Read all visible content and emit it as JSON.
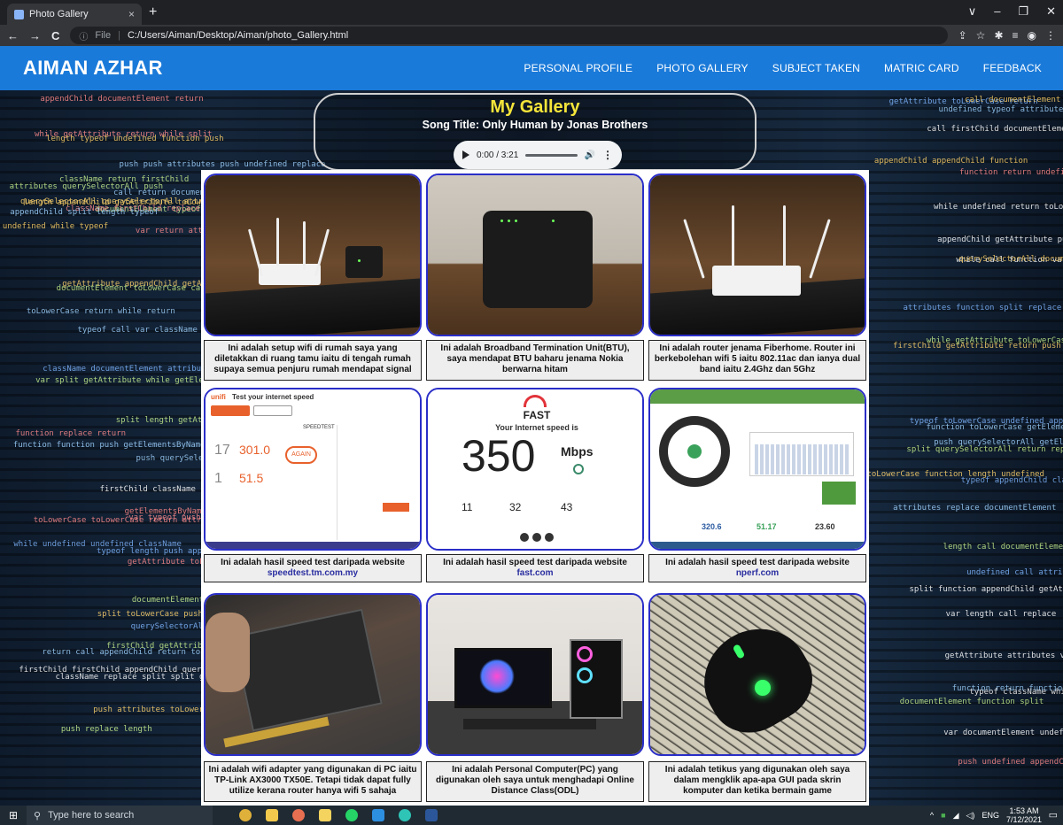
{
  "browser": {
    "tab_title": "Photo Gallery",
    "tab_close": "×",
    "new_tab": "+",
    "win_controls": [
      "∨",
      "–",
      "❐",
      "✕"
    ],
    "nav_back": "←",
    "nav_forward": "→",
    "nav_reload": "C",
    "address_scheme": "File",
    "address_url": "C:/Users/Aiman/Desktop/Aiman/photo_Gallery.html"
  },
  "navbar": {
    "brand": "AIMAN AZHAR",
    "links": [
      "PERSONAL PROFILE",
      "PHOTO GALLERY",
      "SUBJECT TAKEN",
      "MATRIC CARD",
      "FEEDBACK"
    ],
    "color": "#1a7ad9"
  },
  "gallery_header": {
    "title": "My Gallery",
    "song": "Song Title: Only Human by Jonas Brothers",
    "audio_time": "0:00 / 3:21",
    "audio_progress": 0,
    "title_color": "#f5e53a"
  },
  "cards": [
    {
      "caption": "Ini adalah setup wifi di rumah saya yang diletakkan di ruang tamu iaitu di tengah rumah supaya semua penjuru rumah mendapat signal",
      "link": ""
    },
    {
      "caption": "Ini adalah Broadband Termination Unit(BTU), saya mendapat BTU baharu jenama Nokia berwarna hitam",
      "link": ""
    },
    {
      "caption": "Ini adalah router jenama Fiberhome. Router ini berkebolehan wifi 5 iaitu 802.11ac dan ianya dual band iaitu 2.4Ghz dan 5Ghz",
      "link": ""
    },
    {
      "caption": "Ini adalah hasil speed test daripada website",
      "link": "speedtest.tm.com.my"
    },
    {
      "caption": "Ini adalah hasil speed test daripada website",
      "link": "fast.com"
    },
    {
      "caption": "Ini adalah hasil speed test daripada website",
      "link": "nperf.com"
    },
    {
      "caption": "Ini adalah wifi adapter yang digunakan di PC iaitu TP-Link AX3000 TX50E. Tetapi tidak dapat fully utilize kerana router hanya wifi 5 sahaja",
      "link": ""
    },
    {
      "caption": "Ini adalah Personal Computer(PC) yang digunakan oleh saya untuk menghadapi Online Distance Class(ODL)",
      "link": ""
    },
    {
      "caption": "Ini adalah tetikus yang digunakan oleh saya dalam mengklik apa-apa GUI pada skrin komputer dan ketika bermain game",
      "link": ""
    }
  ],
  "screenshots": {
    "tm": {
      "brand": "unifi",
      "heading": "Test your internet speed",
      "value1": "17",
      "value2": "301.0",
      "value3": "1",
      "value4": "51.5",
      "again": "AGAIN",
      "speedtest": "SPEEDTEST"
    },
    "fast": {
      "logo": "FAST",
      "label": "Your Internet speed is",
      "value": "350",
      "unit": "Mbps",
      "latency": "11",
      "loaded": "32",
      "upload": "43"
    },
    "nperf": {
      "download": "320.6",
      "upload": "51.17",
      "latency": "23.60"
    }
  },
  "taskbar": {
    "search_placeholder": "Type here to search",
    "lang": "ENG",
    "time": "1:53 AM",
    "date": "7/12/2021"
  }
}
